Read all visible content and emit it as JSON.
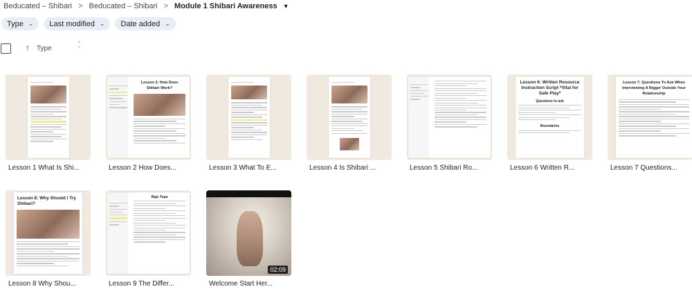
{
  "breadcrumb": {
    "items": [
      "Beducated – Shibari",
      "Beducated – Shibari",
      "Module 1 Shibari Awareness"
    ]
  },
  "filters": [
    "Type",
    "Last modified",
    "Date added"
  ],
  "sort": {
    "label": "Type"
  },
  "files": [
    {
      "name": "Lesson 1 What Is Shi...",
      "kind": "doc"
    },
    {
      "name": "Lesson 2 How Does...",
      "kind": "doc",
      "heading": "Lesson 2: How Does Shibari Work?"
    },
    {
      "name": "Lesson 3 What To E...",
      "kind": "doc"
    },
    {
      "name": "Lesson 4 Is Shibari ...",
      "kind": "doc"
    },
    {
      "name": "Lesson 5 Shibari Ro...",
      "kind": "doc"
    },
    {
      "name": "Lesson 6 Written R...",
      "kind": "doc",
      "heading": "Lesson 6: Written Resource Instruction Script *Vital for Safe Play*",
      "sub1": "Questions to ask",
      "sub2": "Boundaries"
    },
    {
      "name": "Lesson 7 Questions...",
      "kind": "doc",
      "heading": "Lesson 7: Questions To Ask When Interviewing A Rigger Outside Your Relationship"
    },
    {
      "name": "Lesson 8 Why Shou...",
      "kind": "doc",
      "heading": "Lesson 8: Why Should I Try Shibari?"
    },
    {
      "name": "Lesson 9 The Differ...",
      "kind": "doc",
      "heading": "Bajo Topa"
    },
    {
      "name": "Welcome Start Her...",
      "kind": "video",
      "duration": "02:09"
    }
  ]
}
